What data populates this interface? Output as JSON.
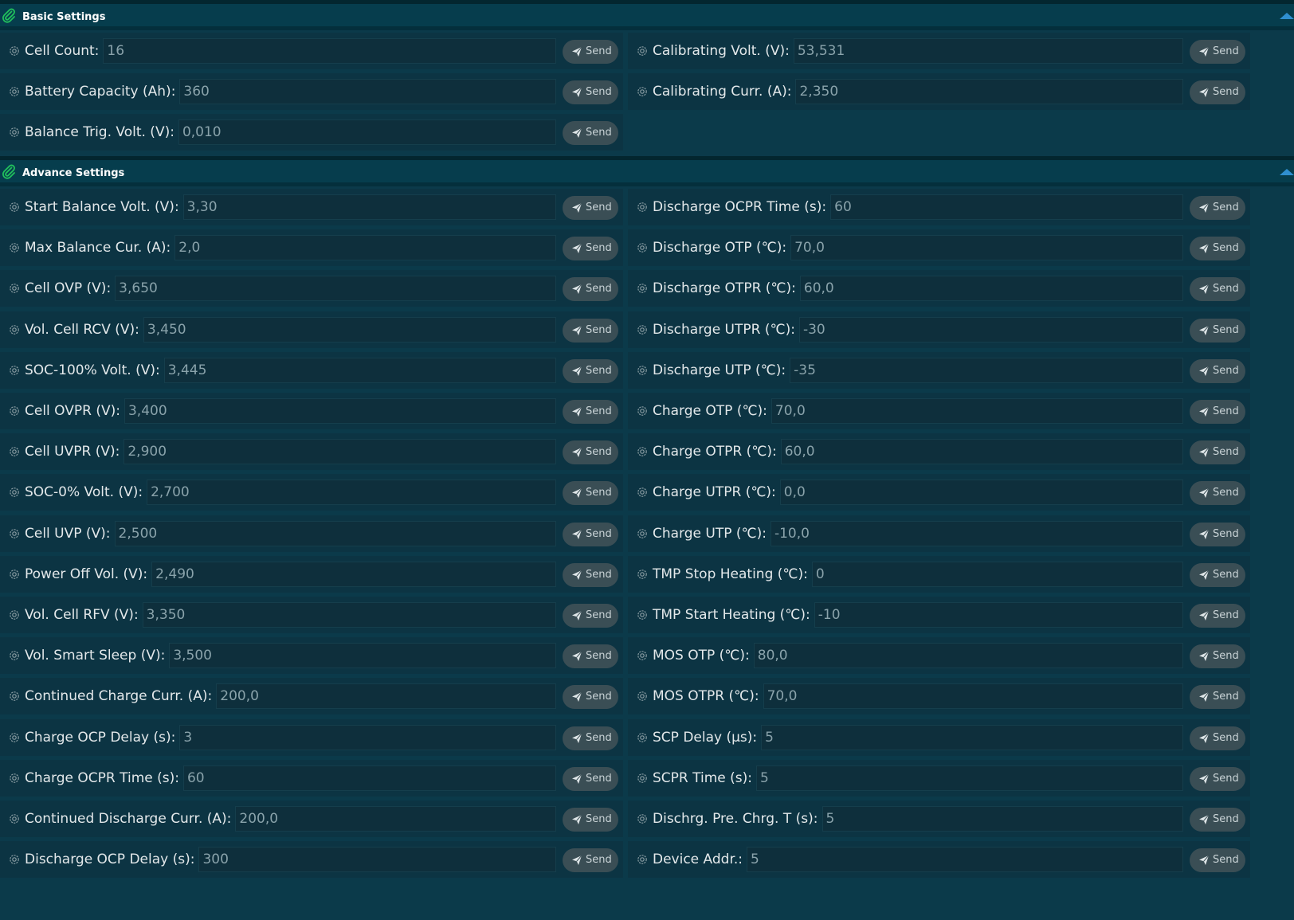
{
  "basic": {
    "title": "Basic Settings",
    "left": [
      {
        "label": "Cell Count:",
        "value": "16"
      },
      {
        "label": "Battery Capacity (Ah):",
        "value": "360"
      },
      {
        "label": "Balance Trig. Volt. (V):",
        "value": "0,010"
      }
    ],
    "right": [
      {
        "label": "Calibrating Volt. (V):",
        "value": "53,531"
      },
      {
        "label": "Calibrating Curr. (A):",
        "value": "2,350"
      }
    ]
  },
  "advance": {
    "title": "Advance Settings",
    "left": [
      {
        "label": "Start Balance Volt. (V):",
        "value": "3,30"
      },
      {
        "label": "Max Balance Cur. (A):",
        "value": "2,0"
      },
      {
        "label": "Cell OVP (V):",
        "value": "3,650"
      },
      {
        "label": "Vol. Cell RCV (V):",
        "value": "3,450"
      },
      {
        "label": "SOC-100% Volt. (V):",
        "value": "3,445"
      },
      {
        "label": "Cell OVPR (V):",
        "value": "3,400"
      },
      {
        "label": "Cell UVPR (V):",
        "value": "2,900"
      },
      {
        "label": "SOC-0% Volt. (V):",
        "value": "2,700"
      },
      {
        "label": "Cell UVP (V):",
        "value": "2,500"
      },
      {
        "label": "Power Off Vol. (V):",
        "value": "2,490"
      },
      {
        "label": "Vol. Cell RFV (V):",
        "value": "3,350"
      },
      {
        "label": "Vol. Smart Sleep (V):",
        "value": "3,500"
      },
      {
        "label": "Continued Charge Curr. (A):",
        "value": "200,0"
      },
      {
        "label": "Charge OCP Delay (s):",
        "value": "3"
      },
      {
        "label": "Charge OCPR Time (s):",
        "value": "60"
      },
      {
        "label": "Continued Discharge Curr. (A):",
        "value": "200,0"
      },
      {
        "label": "Discharge OCP Delay (s):",
        "value": "300"
      }
    ],
    "right": [
      {
        "label": "Discharge OCPR Time (s):",
        "value": "60"
      },
      {
        "label": "Discharge OTP (℃):",
        "value": "70,0"
      },
      {
        "label": "Discharge OTPR (℃):",
        "value": "60,0"
      },
      {
        "label": "Discharge UTPR (℃):",
        "value": "-30"
      },
      {
        "label": "Discharge UTP (℃):",
        "value": "-35"
      },
      {
        "label": "Charge OTP (℃):",
        "value": "70,0"
      },
      {
        "label": "Charge OTPR (℃):",
        "value": "60,0"
      },
      {
        "label": "Charge UTPR (℃):",
        "value": "0,0"
      },
      {
        "label": "Charge UTP (℃):",
        "value": "-10,0"
      },
      {
        "label": "TMP Stop Heating (℃):",
        "value": "0"
      },
      {
        "label": "TMP Start Heating (℃):",
        "value": "-10"
      },
      {
        "label": "MOS OTP (℃):",
        "value": "80,0"
      },
      {
        "label": "MOS OTPR (℃):",
        "value": "70,0"
      },
      {
        "label": "SCP Delay (μs):",
        "value": "5"
      },
      {
        "label": "SCPR Time (s):",
        "value": "5"
      },
      {
        "label": "Dischrg. Pre. Chrg. T (s):",
        "value": "5"
      },
      {
        "label": "Device Addr.:",
        "value": "5"
      }
    ]
  },
  "send_label": "Send",
  "icons": {
    "section": "paperclip-icon",
    "setting": "gear-icon",
    "send": "paper-plane-icon",
    "collapse": "caret-up-icon"
  },
  "colors": {
    "background": "#042f3c",
    "header": "#063d4d",
    "accent": "#2f8fd0",
    "paperclip": "#21c05c",
    "button": "#3a4e55"
  }
}
